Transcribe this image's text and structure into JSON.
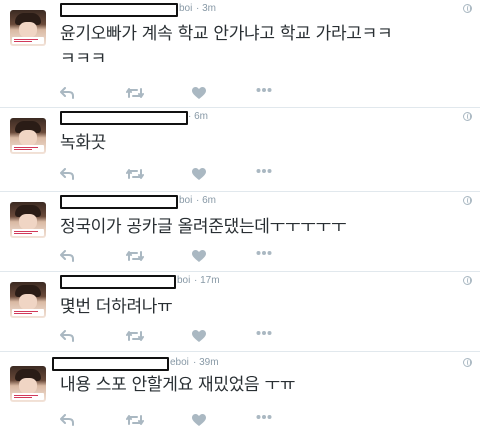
{
  "tweets": [
    {
      "handle_tail": "boi",
      "time": "· 3m",
      "text_lines": [
        "윤기오빠가 계속 학교 안가냐고 학교 가라고ㅋㅋ",
        "ㅋㅋㅋ"
      ]
    },
    {
      "handle_tail": "",
      "time": "· 6m",
      "text_lines": [
        "녹화끗"
      ]
    },
    {
      "handle_tail": "boi",
      "time": "· 6m",
      "text_lines": [
        "정국이가 공카글 올려준댔는데ㅜㅜㅜㅜㅜ"
      ]
    },
    {
      "handle_tail": "boi",
      "time": "· 17m",
      "text_lines": [
        "몇번 더하려나ㅠ"
      ]
    },
    {
      "handle_tail": "eboi",
      "time": "· 39m",
      "text_lines": [
        "내용 스포 안할게요 재밌었음 ㅜㅠ"
      ]
    }
  ],
  "icons": {
    "reply": "reply-icon",
    "retweet": "retweet-icon",
    "like": "heart-icon",
    "more": "more-icon",
    "globe": "globe-icon"
  },
  "colors": {
    "icon_gray": "#aab8c2",
    "meta_gray": "#8899a6",
    "text": "#292f33",
    "divider": "#e1e8ed"
  }
}
